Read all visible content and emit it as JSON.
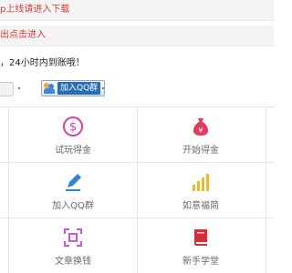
{
  "notices": [
    {
      "text": "p上线请进入下载",
      "color": "#d43b3b"
    },
    {
      "text": "出点击进入",
      "color": "#d43b3b"
    },
    {
      "text": "，24小时内到账哦！",
      "color": "#1f1f1f"
    }
  ],
  "qq_group_button": {
    "label": "加入QQ群"
  },
  "grid": {
    "items": [
      {
        "label": "试玩得金",
        "icon": "dollar-coin-icon",
        "color": "#d23fa8"
      },
      {
        "label": "开始得金",
        "icon": "money-bag-icon",
        "color": "#e53a5c"
      },
      {
        "label": "加入QQ群",
        "icon": "pencil-icon",
        "color": "#2d86d8"
      },
      {
        "label": "如意福简",
        "icon": "bar-chart-icon",
        "color": "#f1b82b"
      },
      {
        "label": "文章换钱",
        "icon": "scan-icon",
        "color": "#c55ae0"
      },
      {
        "label": "新手学堂",
        "icon": "book-icon",
        "color": "#d92d3a"
      }
    ]
  }
}
